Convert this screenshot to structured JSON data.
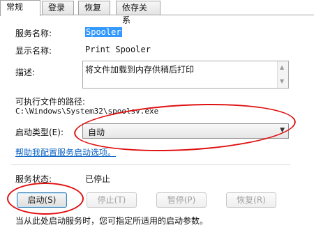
{
  "tabs": [
    "常规",
    "登录",
    "恢复",
    "依存关系"
  ],
  "fields": {
    "service_name_label": "服务名称:",
    "service_name_value": "Spooler",
    "display_name_label": "显示名称:",
    "display_name_value": "Print Spooler",
    "description_label": "描述:",
    "description_value": "将文件加载到内存供稍后打印",
    "exe_path_label": "可执行文件的路径:",
    "exe_path_value": "C:\\Windows\\System32\\spoolsv.exe",
    "startup_type_label": "启动类型(E):",
    "startup_type_value": "自动",
    "help_link": "帮助我配置服务启动选项。",
    "service_status_label": "服务状态:",
    "service_status_value": "已停止",
    "footer_text": "当从此处启动服务时，您可指定所适用的启动参数。"
  },
  "buttons": {
    "start": "启动(S)",
    "stop": "停止(T)",
    "pause": "暂停(P)",
    "resume": "恢复(R)"
  },
  "colors": {
    "annotation": "#e01010",
    "selection": "#3399ff",
    "link": "#0a62c5"
  }
}
